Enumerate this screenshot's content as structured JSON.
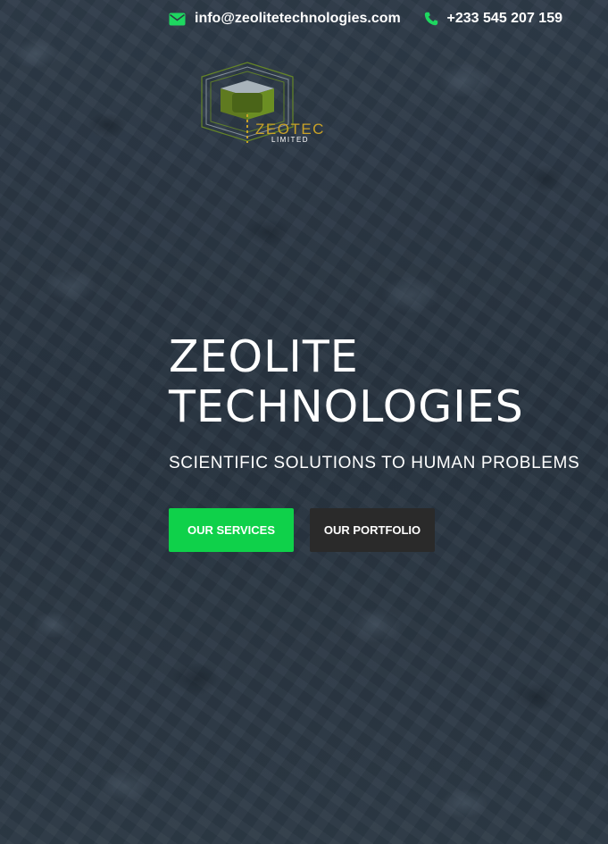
{
  "topbar": {
    "email": "info@zeolitetechnologies.com",
    "phone": "+233 545 207 159",
    "email_icon": "envelope-icon",
    "phone_icon": "phone-icon",
    "icon_color": "#1ed760"
  },
  "logo": {
    "name": "ZEOTEC",
    "tagline": "LIMITED",
    "colors": {
      "green": "#6b8e23",
      "gold": "#c9a227",
      "gray": "#9aa5ad"
    }
  },
  "hero": {
    "title": "ZEOLITE TECHNOLOGIES",
    "subtitle": "SCIENTIFIC SOLUTIONS TO HUMAN PROBLEMS"
  },
  "buttons": {
    "services": {
      "label": "OUR SERVICES",
      "color": "#0fd14a"
    },
    "portfolio": {
      "label": "OUR PORTFOLIO",
      "color": "#2a2a2a"
    }
  }
}
